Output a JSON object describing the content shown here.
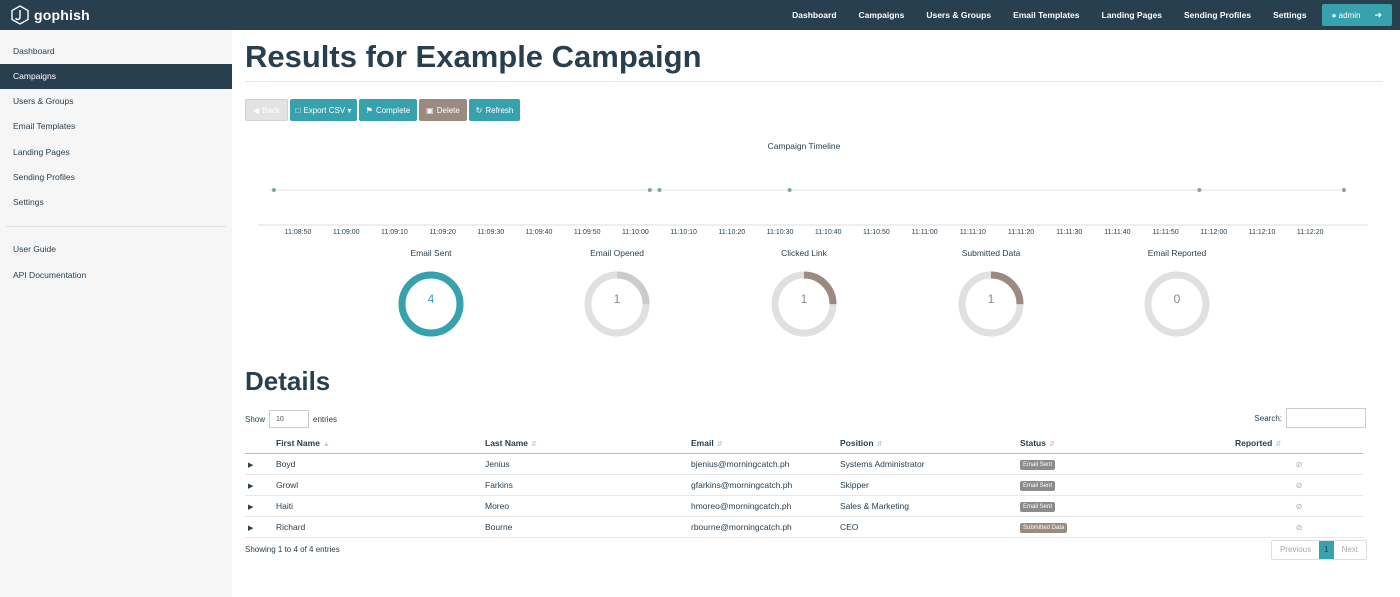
{
  "brand": {
    "name": "gophish",
    "logo_icon": "gophish-logo-icon"
  },
  "topnav": {
    "items": [
      "Dashboard",
      "Campaigns",
      "Users & Groups",
      "Email Templates",
      "Landing Pages",
      "Sending Profiles",
      "Settings"
    ],
    "admin_label": "admin"
  },
  "sidebar": {
    "items": [
      "Dashboard",
      "Campaigns",
      "Users & Groups",
      "Email Templates",
      "Landing Pages",
      "Sending Profiles",
      "Settings"
    ],
    "active": "Campaigns",
    "extra": [
      "User Guide",
      "API Documentation"
    ]
  },
  "page": {
    "title": "Results for Example Campaign"
  },
  "actions": {
    "back": "Back",
    "export": "Export CSV",
    "complete": "Complete",
    "delete": "Delete",
    "refresh": "Refresh"
  },
  "timeline": {
    "title": "Campaign Timeline",
    "ticks": [
      "11:08:50",
      "11:09:00",
      "11:09:10",
      "11:09:20",
      "11:09:30",
      "11:09:40",
      "11:09:50",
      "11:10:00",
      "11:10:10",
      "11:10:20",
      "11:10:30",
      "11:10:40",
      "11:10:50",
      "11:11:00",
      "11:11:10",
      "11:11:20",
      "11:11:30",
      "11:11:40",
      "11:11:50",
      "11:12:00",
      "11:12:10",
      "11:12:20"
    ],
    "events": [
      "11:08:45",
      "11:10:03",
      "11:10:05",
      "11:10:32",
      "11:11:57",
      "11:12:27"
    ]
  },
  "stats": [
    {
      "label": "Email Sent",
      "value": "4",
      "fraction": 1.0,
      "color": "#37a1ae",
      "dotted": false
    },
    {
      "label": "Email Opened",
      "value": "1",
      "fraction": 0.25,
      "color": "#dddddd",
      "dotted": true
    },
    {
      "label": "Clicked Link",
      "value": "1",
      "fraction": 0.25,
      "color": "#9b8a80",
      "dotted": false
    },
    {
      "label": "Submitted Data",
      "value": "1",
      "fraction": 0.25,
      "color": "#9b8a80",
      "dotted": false
    },
    {
      "label": "Email Reported",
      "value": "0",
      "fraction": 0,
      "color": "#dddddd",
      "dotted": false
    }
  ],
  "details": {
    "title": "Details",
    "show_prefix": "Show",
    "show_value": "10",
    "show_suffix": "entries",
    "search_label": "Search:",
    "columns": [
      "First Name",
      "Last Name",
      "Email",
      "Position",
      "Status",
      "Reported"
    ],
    "rows": [
      {
        "first": "Boyd",
        "last": "Jenius",
        "email": "bjenius@morningcatch.ph",
        "position": "Systems Administrator",
        "status": "Email Sent"
      },
      {
        "first": "Growl",
        "last": "Farkins",
        "email": "gfarkins@morningcatch.ph",
        "position": "Skipper",
        "status": "Email Sent"
      },
      {
        "first": "Haiti",
        "last": "Moreo",
        "email": "hmoreo@morningcatch.ph",
        "position": "Sales & Marketing",
        "status": "Email Sent"
      },
      {
        "first": "Richard",
        "last": "Bourne",
        "email": "rbourne@morningcatch.ph",
        "position": "CEO",
        "status": "Submitted Data"
      }
    ],
    "showing": "Showing 1 to 4 of 4 entries",
    "pagination": {
      "previous": "Previous",
      "current": "1",
      "next": "Next"
    }
  },
  "colors": {
    "navy": "#283f50",
    "teal": "#37a1ae",
    "brown": "#9b8a80",
    "gray_badge": "#8b8b8b"
  }
}
